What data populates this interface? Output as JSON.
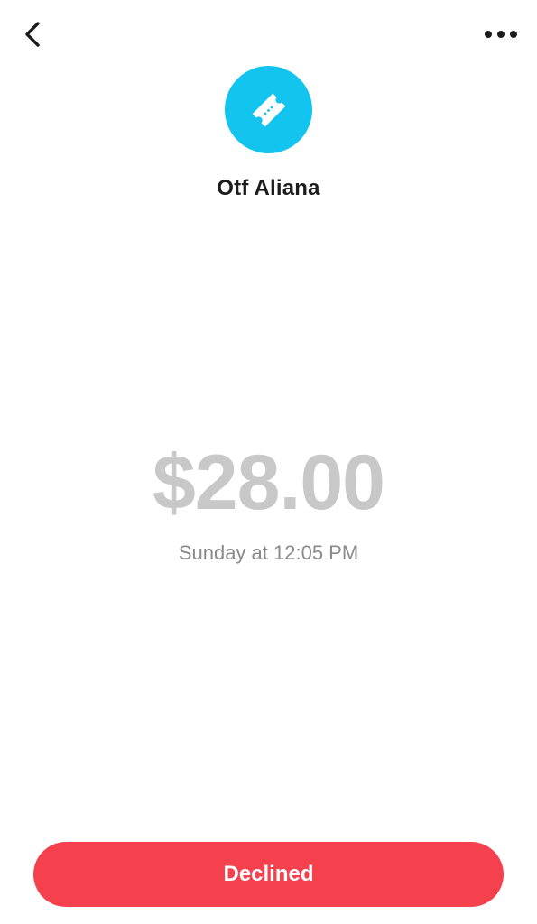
{
  "header": {
    "back_icon": "chevron-left-icon",
    "more_icon": "ellipsis-horizontal-icon"
  },
  "merchant": {
    "name": "Otf Aliana",
    "icon": "ticket-icon",
    "avatar_color": "#13c5ee"
  },
  "transaction": {
    "amount": "$28.00",
    "amount_color": "#c8c8c8",
    "timestamp": "Sunday at 12:05 PM"
  },
  "status": {
    "label": "Declined",
    "color": "#f5404e"
  }
}
